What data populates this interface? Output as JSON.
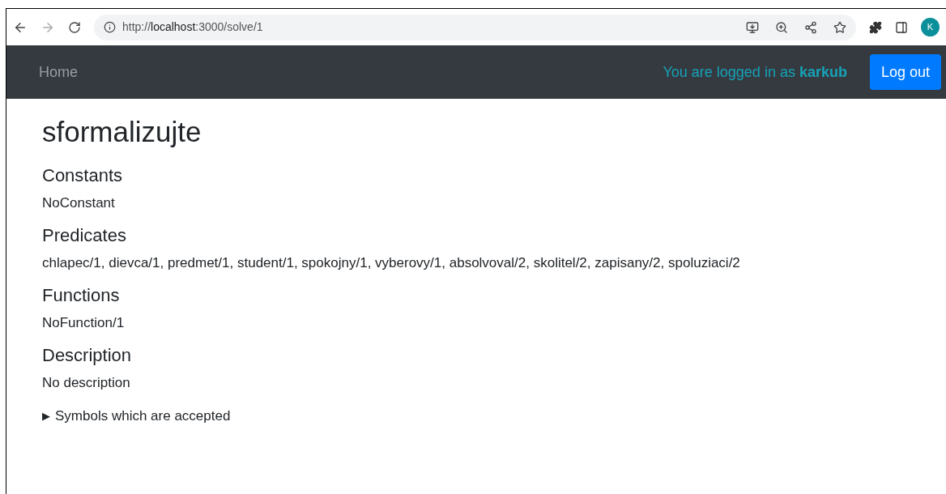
{
  "browser": {
    "url": "http://**localhost**:3000/solve/1",
    "avatar": "K"
  },
  "navbar": {
    "home": "Home",
    "login_text": "You are logged in as **karkub**",
    "logout": "Log out"
  },
  "title": "sformalizujte",
  "sections": [
    {
      "heading": "Constants",
      "text": "NoConstant"
    },
    {
      "heading": "Predicates",
      "text": "chlapec/1, dievca/1, predmet/1, student/1, spokojny/1, vyberovy/1, absolvoval/2, skolitel/2, zapisany/2, spoluziaci/2"
    },
    {
      "heading": "Functions",
      "text": "NoFunction/1"
    },
    {
      "heading": "Description",
      "text": "No description"
    }
  ],
  "details": {
    "marker": "▶",
    "summary": "Symbols which are accepted",
    "expanded": false
  }
}
